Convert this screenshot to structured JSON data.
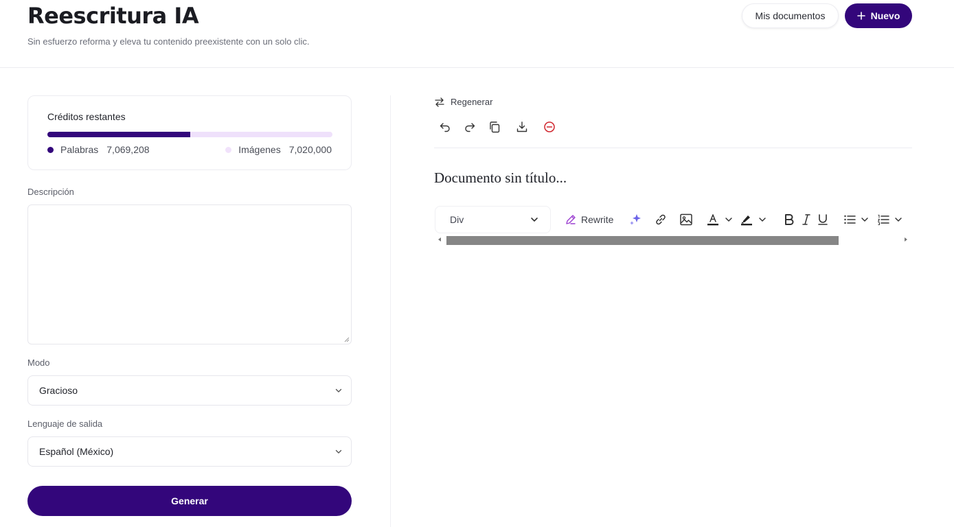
{
  "header": {
    "title": "Reescritura IA",
    "subtitle": "Sin esfuerzo reforma y eleva tu contenido preexistente con un solo clic.",
    "my_documents": "Mis documentos",
    "new_button": "Nuevo"
  },
  "credits": {
    "title": "Créditos restantes",
    "words_label": "Palabras",
    "words_value": "7,069,208",
    "images_label": "Imágenes",
    "images_value": "7,020,000",
    "words_fraction": 0.5017,
    "colors": {
      "words": "#33067b",
      "images": "#f1e2fb"
    }
  },
  "form": {
    "description_label": "Descripción",
    "description_value": "",
    "mode_label": "Modo",
    "mode_value": "Gracioso",
    "language_label": "Lenguaje de salida",
    "language_value": "Español (México)",
    "generate_button": "Generar"
  },
  "editor": {
    "regenerate": "Regenerar",
    "document_title": "Documento sin título...",
    "block_type": "Div",
    "rewrite": "Rewrite",
    "actions": [
      "undo-icon",
      "redo-icon",
      "copy-icon",
      "download-icon",
      "delete-icon"
    ],
    "toolbar_icons": [
      "sparkle-icon",
      "link-icon",
      "image-icon",
      "font-color-icon",
      "highlight-icon",
      "bold-icon",
      "italic-icon",
      "underline-icon",
      "bullet-list-icon",
      "numbered-list-icon"
    ]
  },
  "colors": {
    "brand": "#33067b",
    "danger": "#d0252d",
    "sparkle": "#6b63e8",
    "rewrite_icon": "#9b3fd0"
  }
}
